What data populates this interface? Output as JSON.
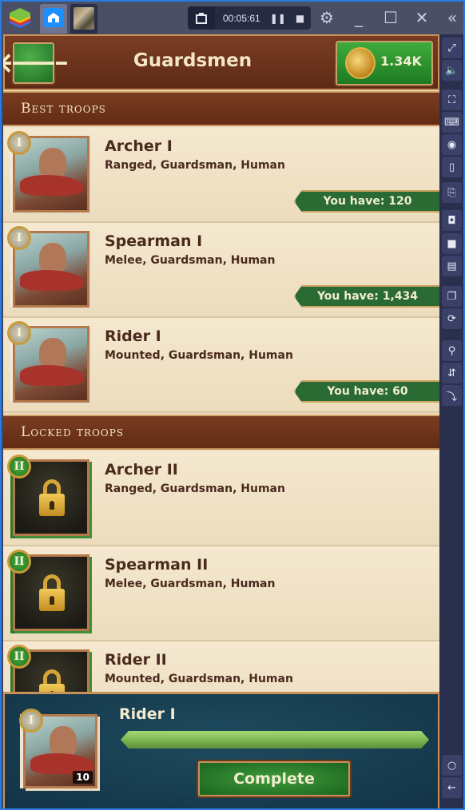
{
  "window": {
    "recording_time": "00:05:61",
    "tabs": [
      {
        "name": "home",
        "icon": "home-icon"
      },
      {
        "name": "game",
        "icon": "game-thumbnail"
      }
    ],
    "controls": [
      "gear-icon",
      "minimize-icon",
      "maximize-icon",
      "close-icon",
      "collapse-sidebar-icon"
    ]
  },
  "sidebar": {
    "items": [
      {
        "name": "fullscreen",
        "glyph": "⤢"
      },
      {
        "name": "volume",
        "glyph": "🔈"
      },
      {
        "name": "screen-select",
        "glyph": "⛶"
      },
      {
        "name": "keyboard",
        "glyph": "⌨"
      },
      {
        "name": "eye",
        "glyph": "◉"
      },
      {
        "name": "device",
        "glyph": "▯"
      },
      {
        "name": "paste-apk",
        "glyph": "⎘"
      },
      {
        "name": "screenshot",
        "glyph": "◘"
      },
      {
        "name": "record",
        "glyph": "■"
      },
      {
        "name": "media",
        "glyph": "▤"
      },
      {
        "name": "multi-instance",
        "glyph": "❐"
      },
      {
        "name": "sync",
        "glyph": "⟳"
      },
      {
        "name": "location",
        "glyph": "⚲"
      },
      {
        "name": "shake",
        "glyph": "⇵"
      },
      {
        "name": "rotate",
        "glyph": "⤵"
      },
      {
        "name": "home",
        "glyph": "○"
      },
      {
        "name": "back",
        "glyph": "←"
      }
    ]
  },
  "header": {
    "back_glyph": "🡐",
    "title": "Guardsmen",
    "gold_value": "1.34K"
  },
  "sections": {
    "best": "Best troops",
    "locked": "Locked troops"
  },
  "best_troops": [
    {
      "name": "Archer I",
      "tags": "Ranged, Guardsman, Human",
      "tier": "I",
      "have": "You have: 120"
    },
    {
      "name": "Spearman I",
      "tags": "Melee, Guardsman, Human",
      "tier": "I",
      "have": "You have: 1,434"
    },
    {
      "name": "Rider I",
      "tags": "Mounted, Guardsman, Human",
      "tier": "I",
      "have": "You have: 60"
    }
  ],
  "locked_troops": [
    {
      "name": "Archer II",
      "tags": "Ranged, Guardsman, Human",
      "tier": "II"
    },
    {
      "name": "Spearman II",
      "tags": "Melee, Guardsman, Human",
      "tier": "II"
    },
    {
      "name": "Rider II",
      "tags": "Mounted, Guardsman, Human",
      "tier": "II"
    }
  ],
  "training": {
    "name": "Rider I",
    "tier": "I",
    "count": "10",
    "progress": 1.0,
    "button_label": "Complete"
  }
}
